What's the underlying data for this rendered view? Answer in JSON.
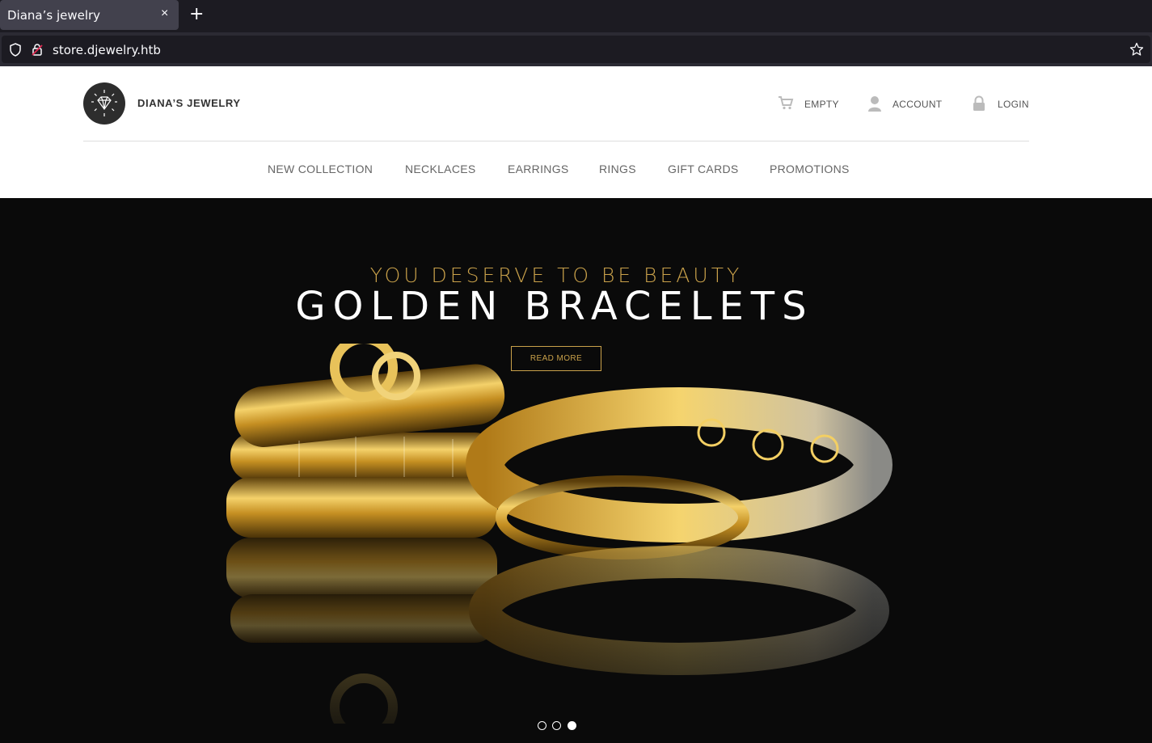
{
  "browser": {
    "tab_title": "Diana’s jewelry",
    "tab_close": "×",
    "new_tab": "+",
    "url": "store.djewelry.htb"
  },
  "header": {
    "logo_text": "DIANA’S JEWELRY",
    "top_nav": {
      "cart": "EMPTY",
      "account": "ACCOUNT",
      "login": "LOGIN"
    },
    "main_nav": [
      "NEW COLLECTION",
      "NECKLACES",
      "EARRINGS",
      "RINGS",
      "GIFT CARDS",
      "PROMOTIONS"
    ]
  },
  "hero": {
    "subtitle": "YOU DESERVE TO BE BEAUTY",
    "title": "GOLDEN BRACELETS",
    "button": "READ MORE",
    "slides": 3,
    "active_slide": 3
  },
  "colors": {
    "gold": "#c9a14a",
    "hero_bg": "#0a0a0a",
    "chrome_bg": "#1c1b22"
  }
}
